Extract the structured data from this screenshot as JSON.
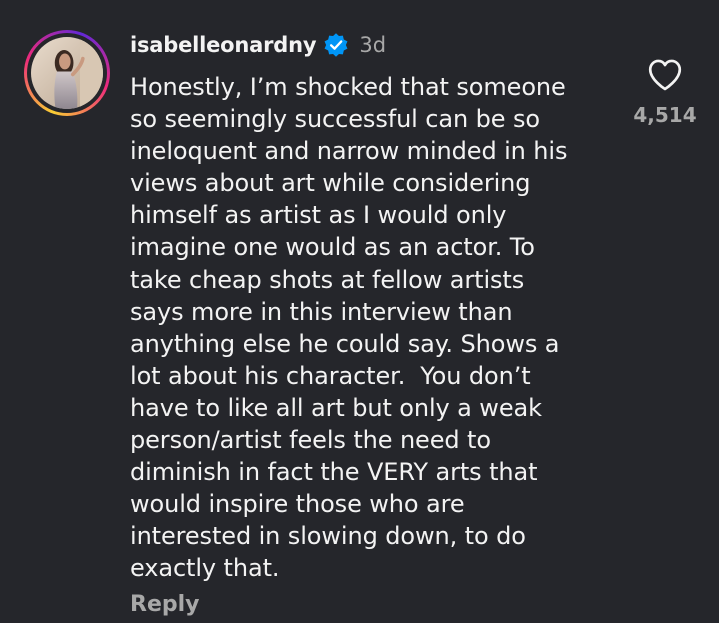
{
  "comment": {
    "username": "isabelleonardny",
    "verified": true,
    "timestamp": "3d",
    "lines": [
      "Honestly, I’m shocked that someone",
      "so seemingly successful can be so",
      "ineloquent and narrow minded in his",
      "views about art while considering",
      "himself as artist as I would only",
      "imagine one would as an actor. To",
      "take cheap shots at fellow artists",
      "says more in this interview than",
      "anything else he could say. Shows a",
      "lot about his character.  You don’t",
      "have to like all art but only a weak",
      "person/artist feels the need to",
      "diminish in fact the VERY arts that",
      "would inspire those who are",
      "interested in slowing down, to do",
      "exactly that."
    ],
    "reply_label": "Reply",
    "like_count": "4,514"
  },
  "icons": {
    "verified": "verified-badge-icon",
    "like": "heart-outline-icon"
  },
  "colors": {
    "background": "#25262b",
    "text_primary": "#f3f3f3",
    "text_secondary": "#a8a8a8",
    "verified_blue": "#0095f6"
  }
}
